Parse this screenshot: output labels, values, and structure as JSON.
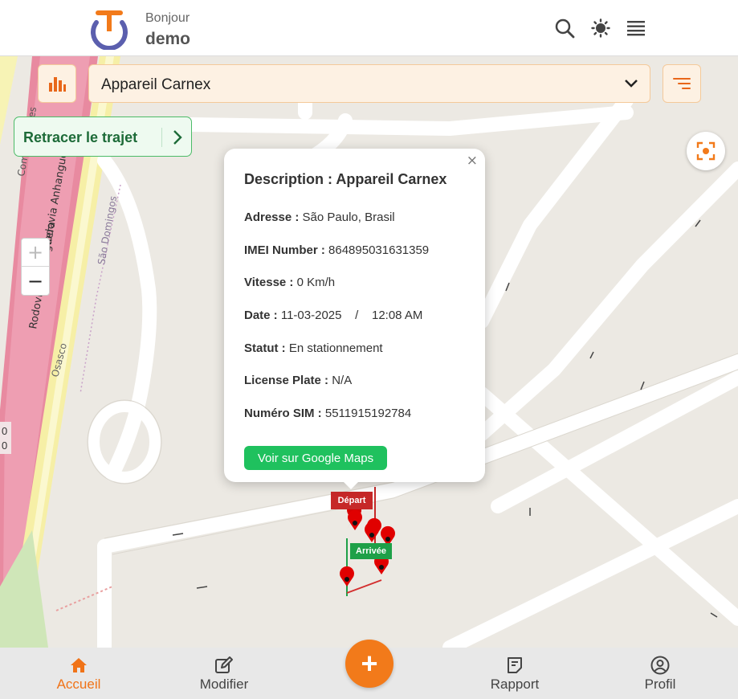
{
  "header": {
    "greeting": "Bonjour",
    "username": "demo",
    "icons": [
      "search-icon",
      "brightness-icon",
      "menu-icon"
    ]
  },
  "toolbar": {
    "device_selected": "Appareil Carnex",
    "retrace_label": "Retracer le trajet"
  },
  "map": {
    "zoom_in": "+",
    "zoom_out": "−",
    "street_labels": [
      "Rodovia Anhanguera",
      "Rodovia Anhanguera",
      "São Domingos",
      "Osasco",
      "Comunicações"
    ],
    "edge_numbers": [
      "0",
      "0"
    ]
  },
  "popup": {
    "close": "×",
    "title": "Description : Appareil Carnex",
    "fields": [
      {
        "label": "Adresse :",
        "value": "São Paulo, Brasil"
      },
      {
        "label": "IMEI Number :",
        "value": "864895031631359"
      },
      {
        "label": "Vitesse :",
        "value": "0 Km/h"
      },
      {
        "label": "Date :",
        "value": "11-03-2025    /    12:08 AM"
      },
      {
        "label": "Statut :",
        "value": "En stationnement"
      },
      {
        "label": "License Plate :",
        "value": "N/A"
      },
      {
        "label": "Numéro SIM :",
        "value": "5511915192784"
      }
    ],
    "gmaps_button": "Voir sur Google Maps"
  },
  "markers": {
    "depart": "Départ",
    "arrivee": "Arrivée"
  },
  "bottom_nav": {
    "items": [
      {
        "label": "Accueil",
        "icon": "home-icon",
        "active": true
      },
      {
        "label": "Modifier",
        "icon": "edit-icon",
        "active": false
      },
      {
        "label": "Rapport",
        "icon": "report-icon",
        "active": false
      },
      {
        "label": "Profil",
        "icon": "profile-icon",
        "active": false
      }
    ],
    "fab": "+"
  },
  "colors": {
    "accent": "#f27a1a",
    "active_nav": "#f07318",
    "success": "#1fc15e",
    "depart": "#c62828",
    "arrivee": "#1ea048"
  }
}
